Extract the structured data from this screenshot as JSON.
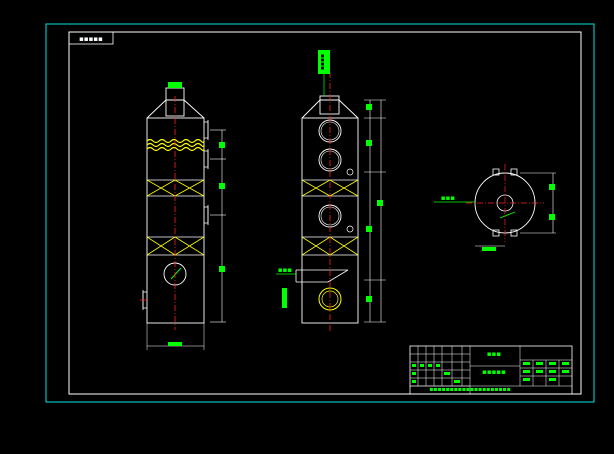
{
  "colors": {
    "background": "#000000",
    "frame": "#00e5e5",
    "outline": "#ffffff",
    "dimension": "#00ff00",
    "centerline": "#ff2020",
    "packing": "#ffff00",
    "label_text": "#00ff00"
  },
  "corner_tag": {
    "text": "▪▪▪▪▪"
  },
  "labels": {
    "side_outlet_tag": "▪▪▪",
    "front_top_tag": "▪▪▪▪",
    "front_inlet_tag": "▪▪▪",
    "plan_inlet_tag": "▪▪▪",
    "dim_left_top": "▪▪▪",
    "dim_left_bottom": "▪▪▪",
    "dim_plan_bottom": "▪▪▪"
  },
  "title_block": {
    "title": "▪▪▪",
    "drawing_name": "▪▪▪▪▪",
    "drawing_no": "▪▪▪▪▪▪▪▪▪▪▪▪▪▪▪▪▪▪▪▪"
  }
}
